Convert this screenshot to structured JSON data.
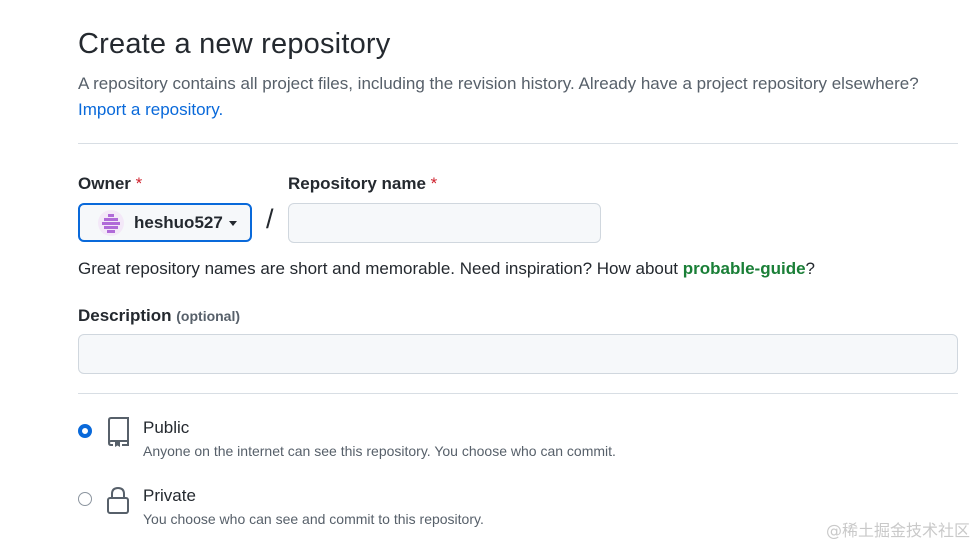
{
  "page": {
    "title": "Create a new repository",
    "intro": "A repository contains all project files, including the revision history. Already have a project repository elsewhere?",
    "import_link": "Import a repository."
  },
  "owner": {
    "label": "Owner",
    "required_mark": "*",
    "selected": "heshuo527",
    "avatar_color": "#b06ad8"
  },
  "separator": "/",
  "repo_name": {
    "label": "Repository name",
    "required_mark": "*",
    "value": ""
  },
  "hint": {
    "text": "Great repository names are short and memorable. Need inspiration? How about ",
    "suggestion": "probable-guide",
    "end": "?"
  },
  "description": {
    "label": "Description",
    "optional": "(optional)",
    "value": ""
  },
  "visibility": {
    "options": [
      {
        "title": "Public",
        "desc": "Anyone on the internet can see this repository. You choose who can commit.",
        "icon": "repo-icon",
        "checked": true
      },
      {
        "title": "Private",
        "desc": "You choose who can see and commit to this repository.",
        "icon": "lock-icon",
        "checked": false
      }
    ]
  },
  "watermark": "@稀土掘金技术社区",
  "colors": {
    "accent": "#0969da",
    "suggestion": "#1a7f37",
    "required": "#cf222e"
  }
}
